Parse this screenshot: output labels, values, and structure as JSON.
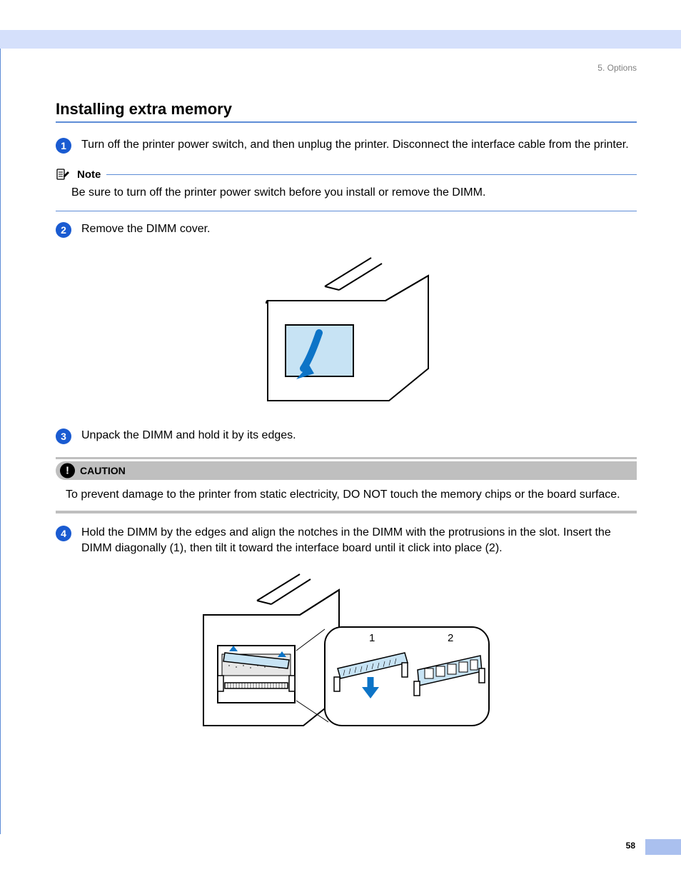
{
  "breadcrumb": "5. Options",
  "section_title": "Installing extra memory",
  "steps": {
    "s1": {
      "num": "1",
      "text": "Turn off the printer power switch, and then unplug the printer. Disconnect the interface cable from the printer."
    },
    "s2": {
      "num": "2",
      "text": "Remove the DIMM cover."
    },
    "s3": {
      "num": "3",
      "text": "Unpack the DIMM and hold it by its edges."
    },
    "s4": {
      "num": "4",
      "text": "Hold the DIMM by the edges and align the notches in the DIMM with the protrusions in the slot. Insert the DIMM diagonally (1), then tilt it toward the interface board until it click into place (2)."
    }
  },
  "note": {
    "label": "Note",
    "text": "Be sure to turn off the printer power switch before you install or remove the DIMM."
  },
  "caution": {
    "label": "CAUTION",
    "text": "To prevent damage to the printer from static electricity, DO NOT touch the memory chips or the board surface."
  },
  "fig2_labels": {
    "l1": "1",
    "l2": "2"
  },
  "page_number": "58"
}
